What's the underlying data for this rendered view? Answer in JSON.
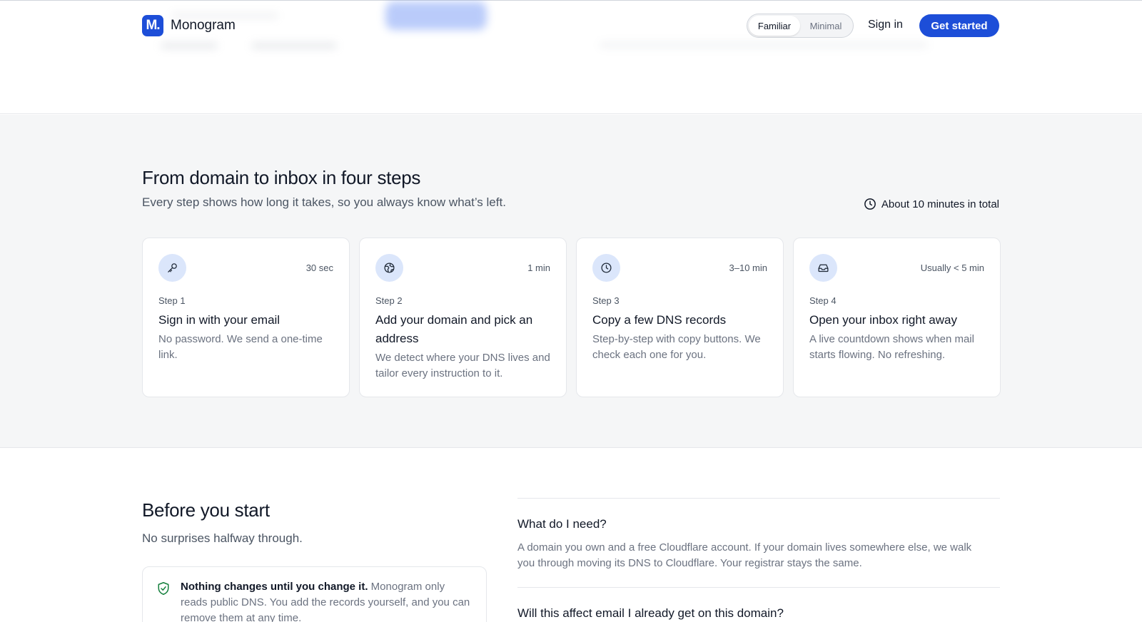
{
  "header": {
    "logo_mark": "M.",
    "logo_text": "Monogram",
    "mode_options": [
      "Familiar",
      "Minimal"
    ],
    "mode_selected": "Familiar",
    "sign_in": "Sign in",
    "cta": "Get started"
  },
  "steps_section": {
    "title": "From domain to inbox in four steps",
    "subtitle": "Every step shows how long it takes, so you always know what’s left.",
    "total_time": "About 10 minutes in total",
    "steps": [
      {
        "icon": "key-icon",
        "duration": "30 sec",
        "step_label": "Step 1",
        "title": "Sign in with your email",
        "description": "No password. We send a one-time link."
      },
      {
        "icon": "globe-icon",
        "duration": "1 min",
        "step_label": "Step 2",
        "title": "Add your domain and pick an address",
        "description": "We detect where your DNS lives and tailor every instruction to it."
      },
      {
        "icon": "clock-icon",
        "duration": "3–10 min",
        "step_label": "Step 3",
        "title": "Copy a few DNS records",
        "description": "Step-by-step with copy buttons. We check each one for you."
      },
      {
        "icon": "inbox-icon",
        "duration": "Usually < 5 min",
        "step_label": "Step 4",
        "title": "Open your inbox right away",
        "description": "A live countdown shows when mail starts flowing. No refreshing."
      }
    ]
  },
  "before_section": {
    "title": "Before you start",
    "subtitle": "No surprises halfway through.",
    "note_strong": "Nothing changes until you change it.",
    "note_text": " Monogram only reads public DNS. You add the records yourself, and you can remove them at any time.",
    "faq": [
      {
        "question": "What do I need?",
        "answer": "A domain you own and a free Cloudflare account. If your domain lives somewhere else, we walk you through moving its DNS to Cloudflare. Your registrar stays the same."
      },
      {
        "question": "Will this affect email I already get on this domain?",
        "answer": ""
      }
    ]
  },
  "colors": {
    "brand": "#1d4ed8",
    "icon_bg": "#dbe6fb",
    "section_bg": "#f5f6f7",
    "shield": "#15803d"
  }
}
